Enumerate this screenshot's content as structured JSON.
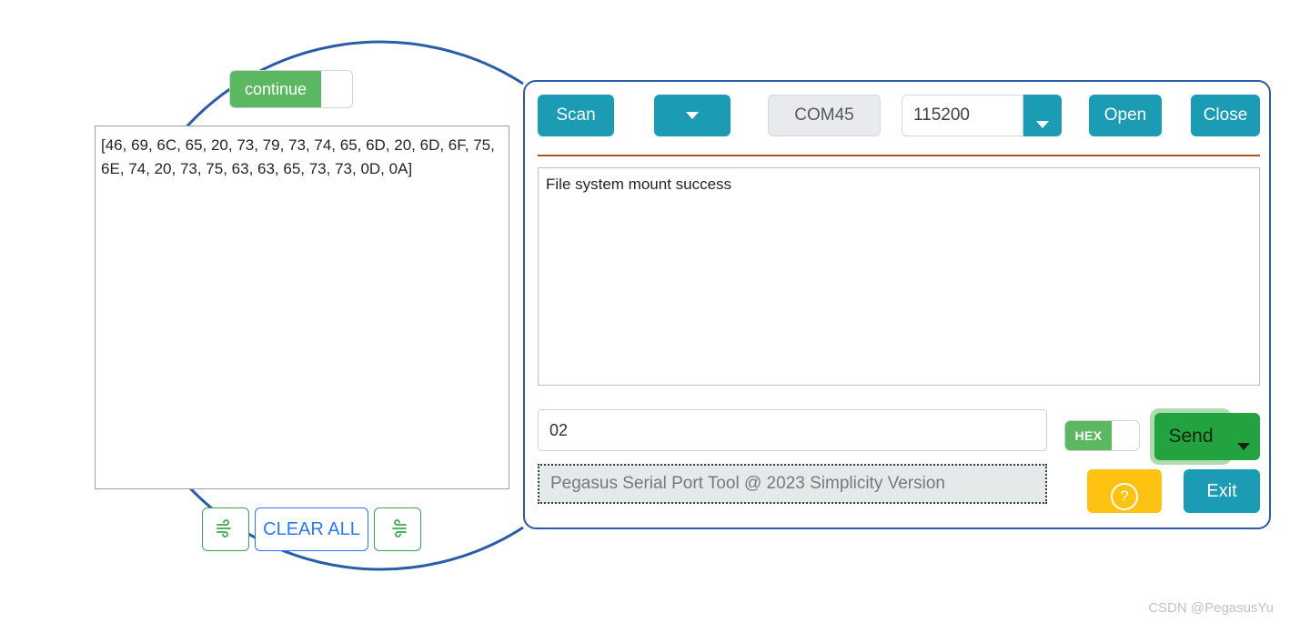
{
  "app": {
    "status_text": "Pegasus Serial Port Tool @ 2023 Simplicity Version",
    "watermark": "CSDN @PegasusYu"
  },
  "toolbar": {
    "scan_label": "Scan",
    "port_dropdown_icon": "chevron-down-icon",
    "port_value": "COM45",
    "baud_value": "115200",
    "baud_dropdown_icon": "chevron-down-icon",
    "open_label": "Open",
    "close_label": "Close"
  },
  "receive": {
    "text": "File system mount success"
  },
  "send": {
    "input_value": "02",
    "hex_toggle_label": "HEX",
    "send_label": "Send",
    "send_dropdown_icon": "chevron-down-icon"
  },
  "footer": {
    "help_icon": "question-circle-icon",
    "exit_label": "Exit"
  },
  "magnifier": {
    "continue_toggle_label": "continue",
    "receive_text": "[46, 69, 6C, 65, 20, 73, 79, 73, 74, 65, 6D, 20, 6D, 6F, 75, 6E, 74, 20, 73, 75, 63, 63, 65, 73, 73, 0D, 0A]",
    "clear_flow_left_icon": "wind-icon",
    "clear_all_label": "CLEAR ALL",
    "clear_flow_right_icon": "wind-icon"
  },
  "colors": {
    "teal": "#1b9cb4",
    "green": "#23a33f",
    "toggle_green": "#5cb860",
    "amber": "#fdc212",
    "blue_outline": "#2a5ca8",
    "orange_rule": "#b1511d",
    "clear_blue": "#2979ff"
  }
}
